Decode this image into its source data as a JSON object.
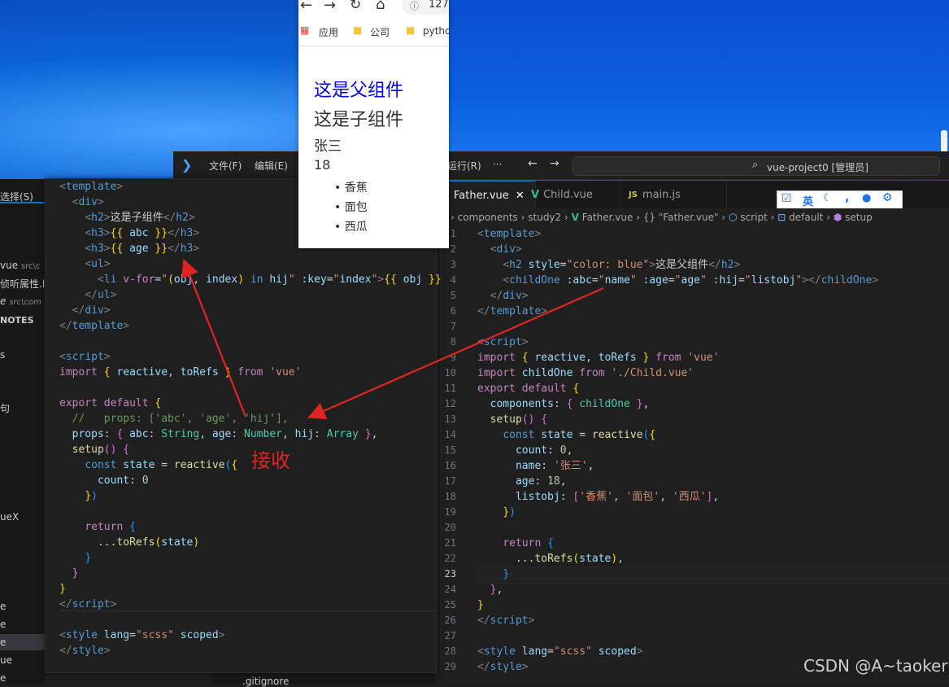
{
  "browser": {
    "address": "127",
    "bookmarks": [
      "应用",
      "公司",
      "pytho"
    ],
    "father_heading": "这是父组件",
    "child_heading": "这是子组件",
    "name": "张三",
    "age": "18",
    "items": [
      "香蕉",
      "面包",
      "西瓜"
    ]
  },
  "vscode_back": {
    "menu": [
      "文件(F)",
      "编辑(E)",
      "运行(R)",
      "···"
    ],
    "search_text": "vue-project0 [管理员]",
    "tabs": [
      {
        "label": "Father.vue",
        "active": true
      },
      {
        "label": "Child.vue",
        "active": false
      },
      {
        "label": "main.js",
        "active": false
      }
    ],
    "breadcrumb": [
      "components",
      "study2",
      "Father.vue",
      "{} \"Father.vue\"",
      "script",
      "default",
      "setup"
    ],
    "current_line": 23
  },
  "explorer_fragments": [
    "选择(S)",
    "vue",
    "src\\c",
    "侦听属性.l",
    "e",
    "src\\com",
    "NOTES",
    "s",
    "句",
    "ueX",
    "e",
    "e",
    "e",
    "ue",
    "e",
    ".gitignore"
  ],
  "ime": {
    "lang": "英"
  },
  "annotation": {
    "label": "接收",
    "color": "#e02424"
  },
  "watermark": "CSDN @A~taoker"
}
